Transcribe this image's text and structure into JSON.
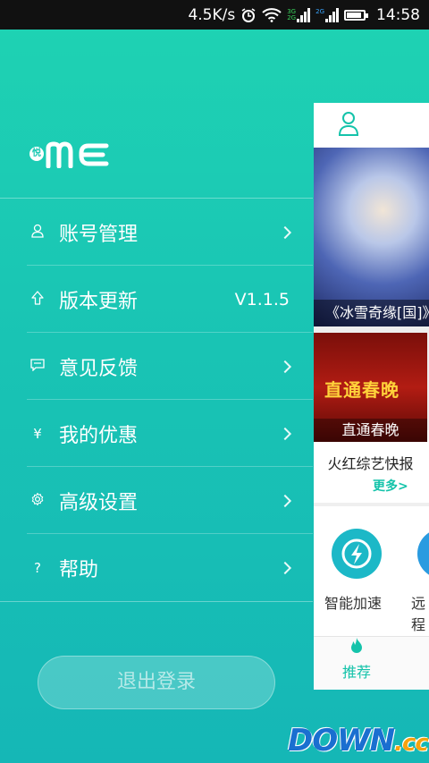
{
  "statusbar": {
    "speed": "4.5K/s",
    "net_top": "3G",
    "net_bottom": "2G",
    "net2": "2G",
    "time": "14:58"
  },
  "logo": {
    "badge": "悦",
    "text": "ME"
  },
  "menu": [
    {
      "icon": "user-icon",
      "label": "账号管理",
      "right": ""
    },
    {
      "icon": "upload-arrow-icon",
      "label": "版本更新",
      "right": "V1.1.5"
    },
    {
      "icon": "chat-icon",
      "label": "意见反馈",
      "right": ""
    },
    {
      "icon": "yen-icon",
      "label": "我的优惠",
      "right": ""
    },
    {
      "icon": "gear-icon",
      "label": "高级设置",
      "right": ""
    },
    {
      "icon": "question-icon",
      "label": "帮助",
      "right": ""
    }
  ],
  "logout_label": "退出登录",
  "panel": {
    "banner_caption": "《冰雪奇缘[国]》",
    "card_big_title": "直通春晚",
    "card_caption": "直通春晚",
    "card_name": "火红综艺快报",
    "more_label": "更多>",
    "service1": "智能加速",
    "service2": "远程",
    "tab_selected": "推荐"
  },
  "watermark": {
    "main": "DOWN",
    "suffix": ".cc"
  },
  "colors": {
    "accent": "#14c3aa",
    "bg_top": "#1fd3b3",
    "bg_bottom": "#15b7b6"
  }
}
